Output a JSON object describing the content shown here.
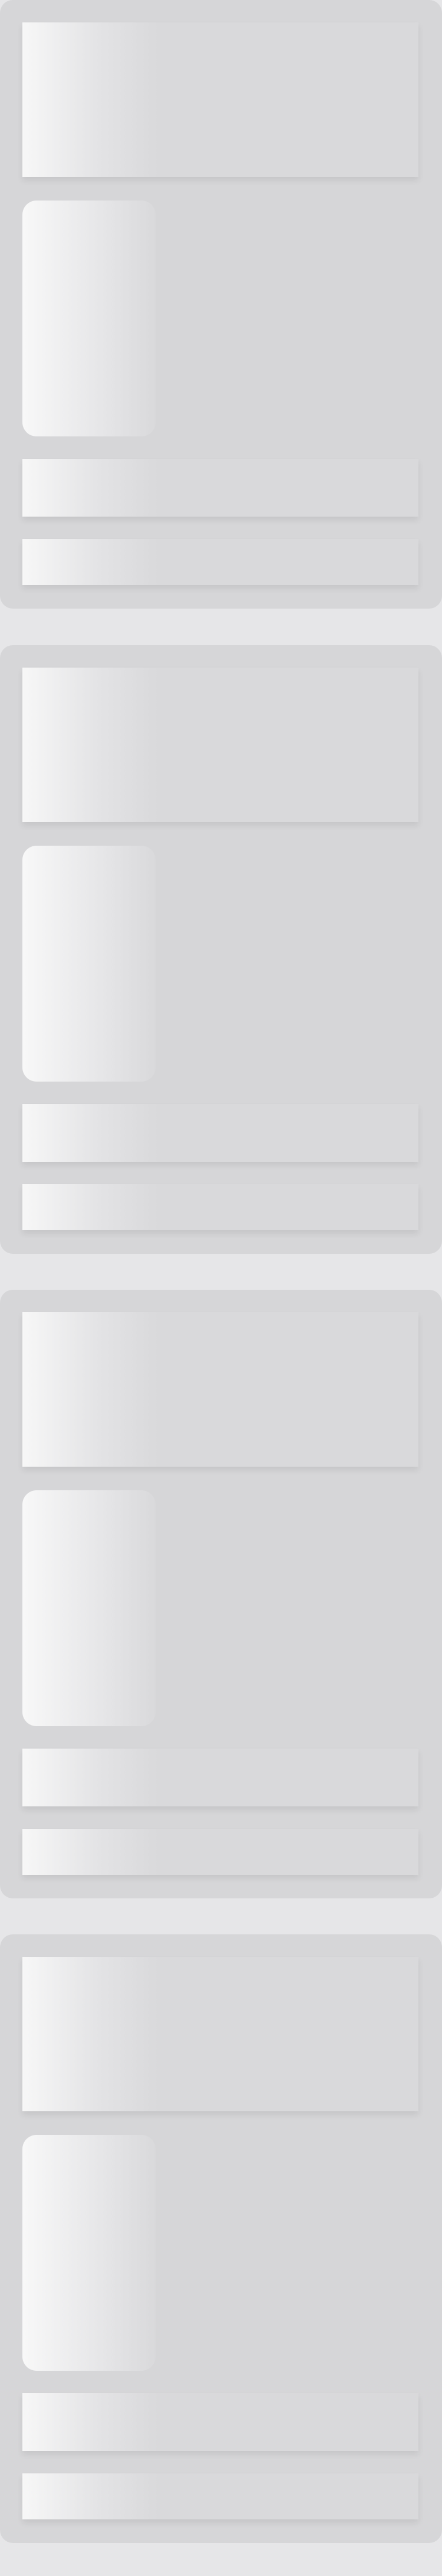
{
  "screen": {
    "state": "loading-skeleton",
    "cards": [
      {
        "blocks": [
          "banner",
          "tile",
          "bar1",
          "bar2"
        ]
      },
      {
        "blocks": [
          "banner",
          "tile",
          "bar1",
          "bar2"
        ]
      },
      {
        "blocks": [
          "banner",
          "tile",
          "bar1",
          "bar2"
        ]
      },
      {
        "blocks": [
          "banner",
          "tile",
          "bar1",
          "bar2"
        ]
      }
    ]
  },
  "colors": {
    "background": "#e6e6e8",
    "card": "#d6d6d8",
    "shimmer_light": "#f7f7f7",
    "shimmer_base": "#d9d9db"
  }
}
